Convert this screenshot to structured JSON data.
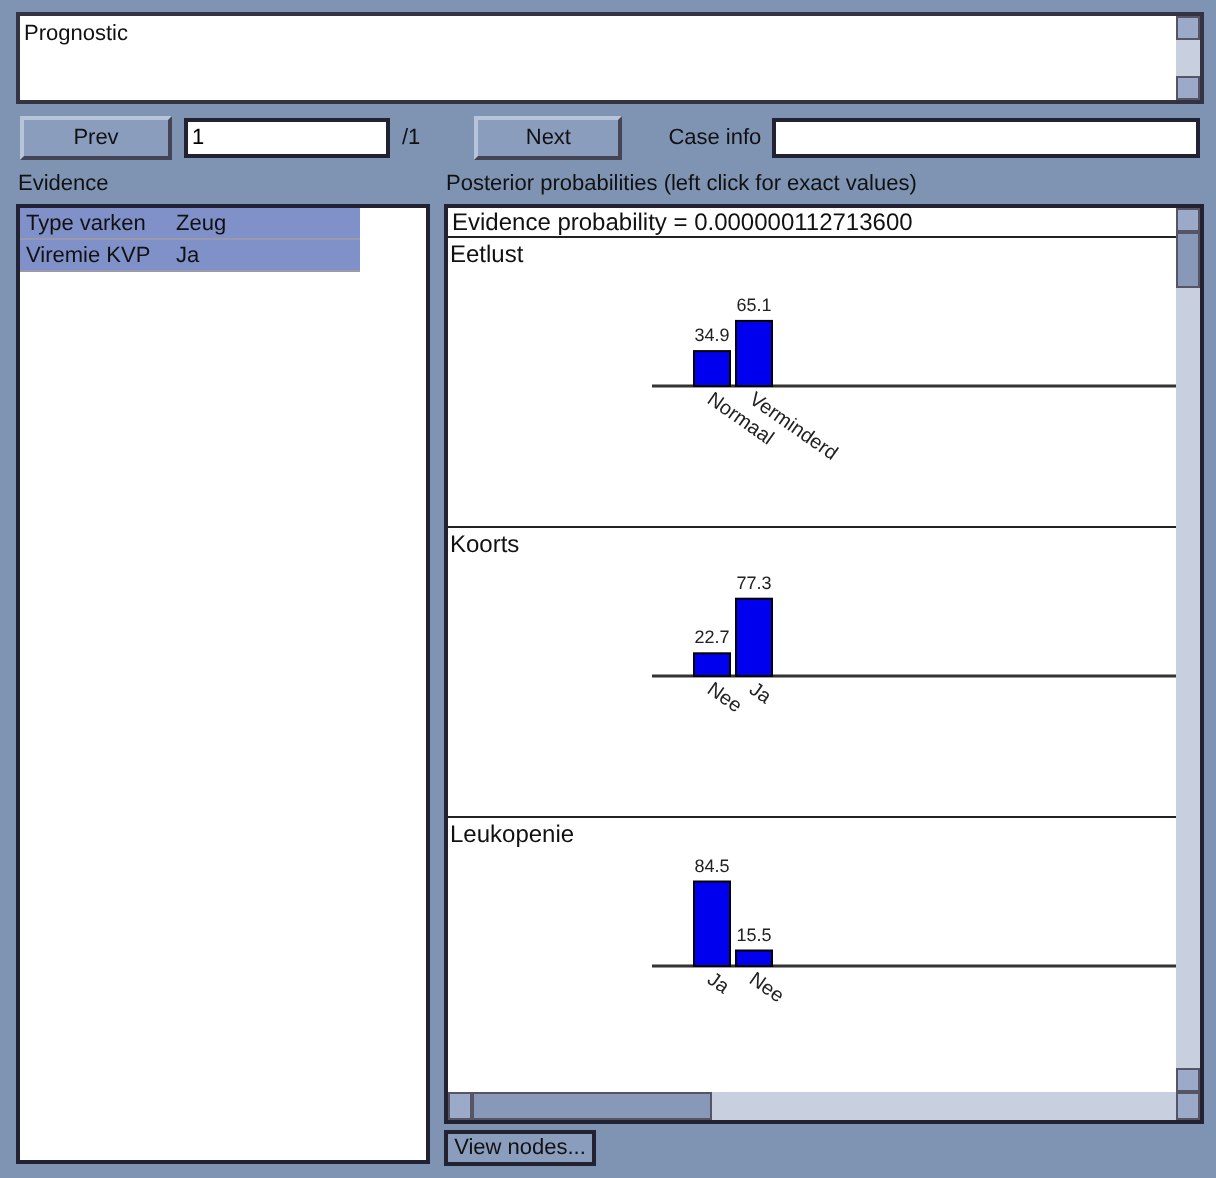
{
  "description": {
    "value": "Prognostic"
  },
  "navigation": {
    "prev": "Prev",
    "case_number": "1",
    "case_total": "/1",
    "next": "Next",
    "case_info_label": "Case info"
  },
  "evidence": {
    "title": "Evidence",
    "rows": [
      {
        "variable": "Type varken",
        "value": "Zeug",
        "selected": true
      },
      {
        "variable": "Viremie KVP",
        "value": "Ja",
        "selected": true
      }
    ]
  },
  "posterior": {
    "title": "Posterior probabilities (left click for exact values)",
    "evidence_probability": "Evidence probability = 0.000000112713600",
    "nodes": [
      {
        "name": "Eetlust",
        "chart_data": {
          "type": "bar",
          "categories": [
            "Normaal",
            "Verminderd"
          ],
          "values": [
            34.9,
            65.1
          ],
          "data_labels": true
        }
      },
      {
        "name": "Koorts",
        "chart_data": {
          "type": "bar",
          "categories": [
            "Nee",
            "Ja"
          ],
          "values": [
            22.7,
            77.3
          ],
          "data_labels": true
        }
      },
      {
        "name": "Leukopenie",
        "chart_data": {
          "type": "bar",
          "categories": [
            "Ja",
            "Nee"
          ],
          "values": [
            84.5,
            15.5
          ],
          "data_labels": true
        }
      }
    ]
  },
  "view_nodes_button": "View nodes..."
}
